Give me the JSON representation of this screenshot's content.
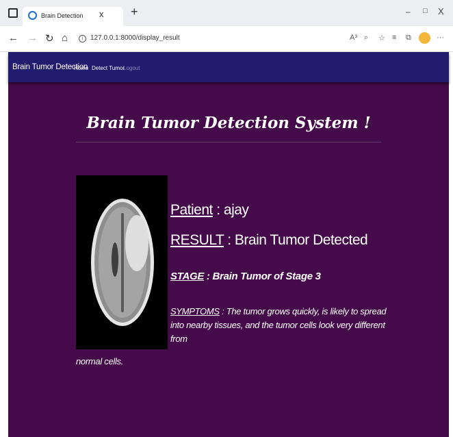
{
  "browser": {
    "tab": {
      "title": "Brain Detection",
      "close": "x"
    },
    "new_tab": "+",
    "window": {
      "minimize": "–",
      "maximize": "□",
      "close": "X"
    },
    "url": "127.0.0.1:8000/display_result",
    "icons": [
      "tab-tray-icon",
      "favicon-icon",
      "back-icon",
      "forward-icon",
      "refresh-icon",
      "home-icon",
      "info-icon",
      "read-aloud-icon",
      "zoom-icon",
      "favorite-icon",
      "favorites-icon",
      "collections-icon",
      "profile-icon",
      "more-icon"
    ],
    "glyphs": {
      "back": "←",
      "forward": "→",
      "refresh": "↻",
      "home": "⌂",
      "info": "i",
      "read": "A³",
      "zoom": "⌕",
      "fav": "☆",
      "favs": "≡",
      "coll": "⧉",
      "more": "···"
    }
  },
  "navbar": {
    "brand": "Brain Tumor Detection",
    "links": [
      "Home",
      "Detect Tumor",
      "Logout"
    ]
  },
  "main": {
    "title": "Brain Tumor Detection System !",
    "patient": {
      "label": "Patient",
      "value": " : ajay"
    },
    "result": {
      "label": "RESULT",
      "value": " : Brain Tumor Detected"
    },
    "stage": {
      "label": "STAGE",
      "value": " : Brain Tumor of Stage 3"
    },
    "symptoms": {
      "label": "SYMPTOMS",
      "value": " : The tumor grows quickly, is likely to spread into nearby tissues, and the tumor cells look very different from",
      "tail": "normal cells."
    }
  },
  "colors": {
    "navbar": "#221c6e",
    "page_bg": "#450a4a",
    "text": "#ffffff"
  }
}
